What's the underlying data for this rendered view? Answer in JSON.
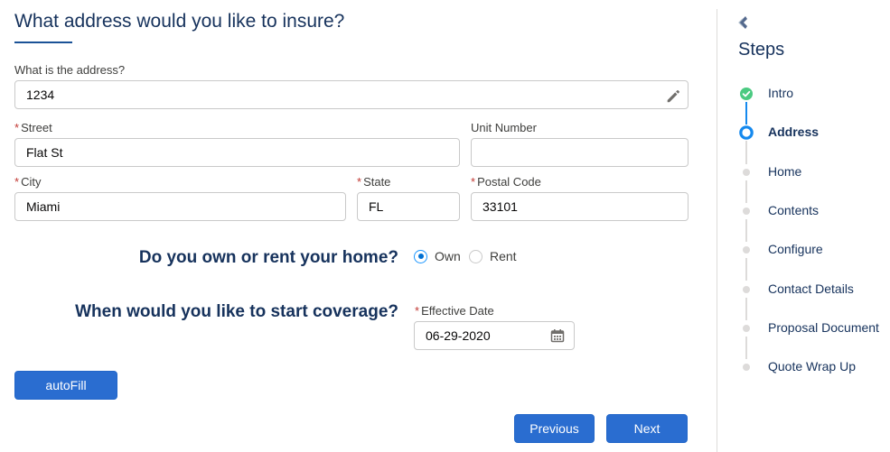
{
  "form": {
    "title": "What address would you like to insure?",
    "address": {
      "label": "What is the address?",
      "value": "1234"
    },
    "street": {
      "label": "Street",
      "value": "Flat St",
      "required_mark": "*"
    },
    "unit": {
      "label": "Unit Number",
      "value": ""
    },
    "city": {
      "label": "City",
      "value": "Miami",
      "required_mark": "*"
    },
    "state": {
      "label": "State",
      "value": "FL",
      "required_mark": "*"
    },
    "postal": {
      "label": "Postal Code",
      "value": "33101",
      "required_mark": "*"
    },
    "own_rent": {
      "question": "Do you own or rent your home?",
      "options": [
        {
          "label": "Own",
          "selected": true
        },
        {
          "label": "Rent",
          "selected": false
        }
      ]
    },
    "coverage": {
      "question": "When would you like to start coverage?",
      "date_label": "Effective Date",
      "date_value": "06-29-2020",
      "required_mark": "*"
    },
    "autofill_label": "autoFill",
    "previous_label": "Previous",
    "next_label": "Next"
  },
  "steps": {
    "title": "Steps",
    "items": [
      {
        "label": "Intro",
        "status": "complete"
      },
      {
        "label": "Address",
        "status": "active"
      },
      {
        "label": "Home",
        "status": "pending"
      },
      {
        "label": "Contents",
        "status": "pending"
      },
      {
        "label": "Configure",
        "status": "pending"
      },
      {
        "label": "Contact Details",
        "status": "pending"
      },
      {
        "label": "Proposal Document",
        "status": "pending"
      },
      {
        "label": "Quote Wrap Up",
        "status": "pending"
      }
    ]
  },
  "icons": {
    "edit": "pencil-icon",
    "calendar": "calendar-icon",
    "complete": "check-circle-icon",
    "collapse": "collapse-panel-icon"
  },
  "colors": {
    "brand": "#2a6dd0",
    "heading": "#16325c",
    "complete": "#4bca81",
    "active": "#1589ee",
    "required": "#c23934"
  }
}
